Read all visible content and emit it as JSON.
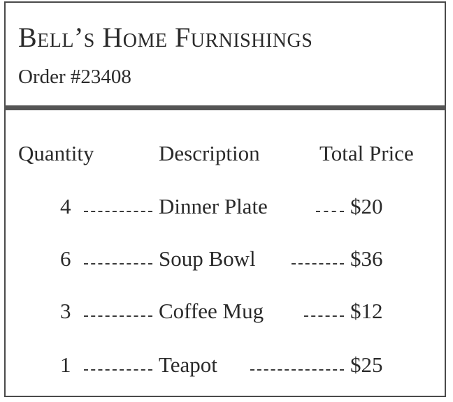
{
  "header": {
    "store_name": "Bell’s Home Furnishings",
    "order_number": "Order #23408"
  },
  "columns": {
    "quantity": "Quantity",
    "description": "Description",
    "total_price": "Total Price"
  },
  "items": [
    {
      "quantity": "4",
      "description": "Dinner Plate",
      "total_price": "$20"
    },
    {
      "quantity": "6",
      "description": "Soup Bowl",
      "total_price": "$36"
    },
    {
      "quantity": "3",
      "description": "Coffee Mug",
      "total_price": "$12"
    },
    {
      "quantity": "1",
      "description": "Teapot",
      "total_price": "$25"
    }
  ]
}
